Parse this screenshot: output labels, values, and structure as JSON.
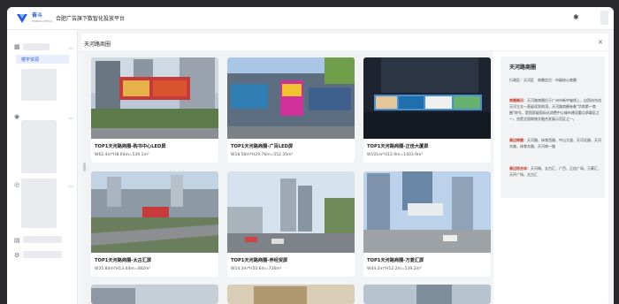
{
  "header": {
    "brand": "奋斗",
    "brand_sub": "FENDOU MEDIA",
    "title": "合肥广告旗下数智化投放平台"
  },
  "sidebar": {
    "active_item": "楼宇资源"
  },
  "panel": {
    "title": "天河路商圈",
    "close_icon": "close-icon"
  },
  "cards": [
    {
      "name": "TOP1天河路商圈-购书中心LED屏",
      "size": "W62.4m*H8.64m=539.1m²"
    },
    {
      "name": "TOP1天河路商圈-广百LED屏",
      "size": "W18.56m*H29.76m=552.35m²"
    },
    {
      "name": "TOP1天河路商圈-正佳大厦屏",
      "size": "W101m*H13.9m=1403.9m²"
    },
    {
      "name": "TOP1天河路商圈-太古汇屏",
      "size": "W35.84m*H13.44m=482m²"
    },
    {
      "name": "TOP1天河路商圈-养经贸屏",
      "size": "W14.3m*H50.6m=726m²"
    },
    {
      "name": "TOP1天河路商圈-万菱汇屏",
      "size": "W44.2m*H12.2m=539.2m²"
    }
  ],
  "detail": {
    "title": "天河路商圈",
    "meta": "行政区：天河区　商圈定位：市级核心商圈",
    "overview_label": "商圈概况：",
    "overview_text": "天河路商圈位于广州市新中轴线上，自西向东由天河立交一直延续到岗顶，天河路商圈有着\"华南第一商圈\"称号，是国家级国际化消费中心城市建设重点承载区之一，也是全国商旅文融合发展示范区之一。",
    "landmarks_label": "周边商圈：",
    "landmarks_text": "天河路、体育西路、中山大道、天河北路、天河东路、体育东路、天河南一路",
    "complex_label": "周边综合体：",
    "complex_text": "天河城、太古汇、广百、正佳广场、万菱汇、天环广场、太古汇"
  }
}
